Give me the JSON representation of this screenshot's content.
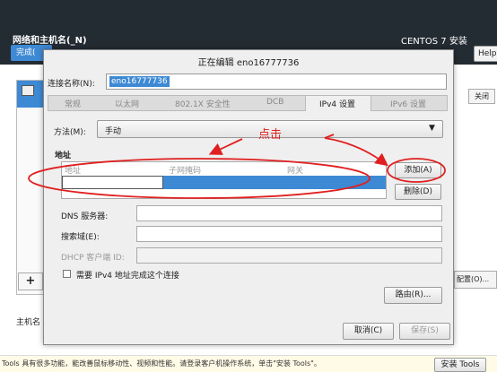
{
  "background": {
    "title": "网络和主机名(_N)",
    "done_button": "完成(",
    "product": "CENTOS 7 安装",
    "help_button": "Help!",
    "close_button": "关闭",
    "config_button": "配置(O)...",
    "add_symbol": "+",
    "hostname_label": "主机名",
    "hint_text": "Tools 具有很多功能，能改善鼠标移动性、视频和性能。请登录客户机操作系统，单击\"安装 Tools\"。",
    "install_tools_button": "安装 Tools"
  },
  "dialog": {
    "title": "正在编辑 eno16777736",
    "connection_name_label": "连接名称(N):",
    "connection_name_value": "eno16777736",
    "tabs": [
      {
        "label": "常规"
      },
      {
        "label": "以太网"
      },
      {
        "label": "802.1X 安全性"
      },
      {
        "label": "DCB"
      },
      {
        "label": "IPv4 设置",
        "active": true
      },
      {
        "label": "IPv6 设置"
      }
    ],
    "method_label": "方法(M):",
    "method_value": "手动",
    "address_section_label": "地址",
    "table_headers": [
      "地址",
      "子网掩码",
      "网关"
    ],
    "add_button": "添加(A)",
    "delete_button": "删除(D)",
    "dns_label": "DNS 服务器:",
    "search_domain_label": "搜索域(E):",
    "dhcp_client_id_label": "DHCP 客户端 ID:",
    "require_ipv4_label": "需要 IPv4 地址完成这个连接",
    "route_button": "路由(R)...",
    "cancel_button": "取消(C)",
    "save_button": "保存(S)"
  },
  "annotation": {
    "text": "点击",
    "color": "#e02020"
  },
  "colors": {
    "accent": "#3e89d4",
    "header_bg": "#232b33"
  }
}
